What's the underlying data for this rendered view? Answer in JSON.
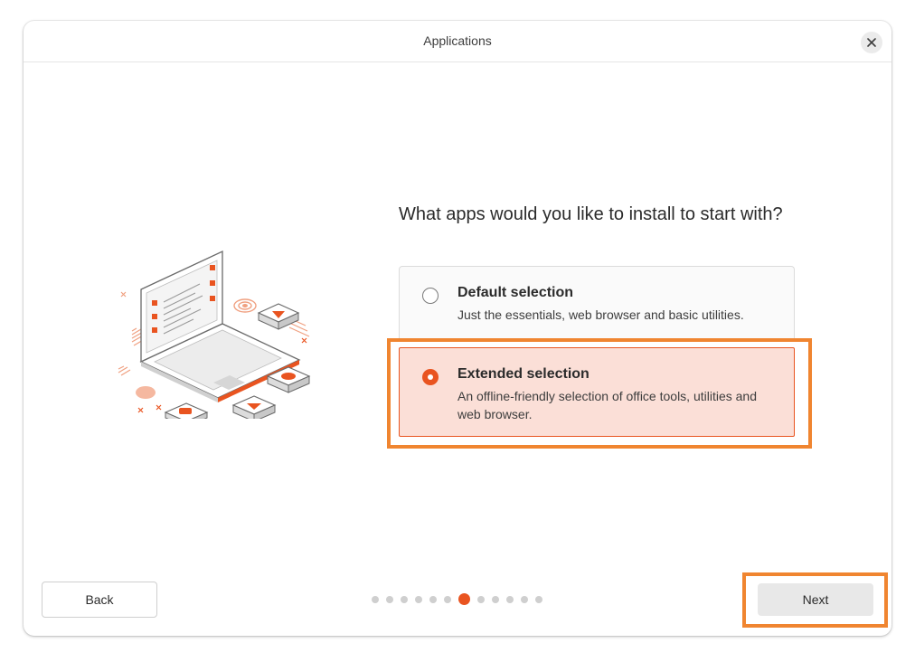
{
  "window": {
    "title": "Applications"
  },
  "page": {
    "question": "What apps would you like to install to start with?"
  },
  "options": [
    {
      "title": "Default selection",
      "description": "Just the essentials, web browser and basic utilities.",
      "selected": false
    },
    {
      "title": "Extended selection",
      "description": "An offline-friendly selection of office tools, utilities and web browser.",
      "selected": true
    }
  ],
  "footer": {
    "back_label": "Back",
    "next_label": "Next",
    "steps_total": 12,
    "current_step": 7
  },
  "colors": {
    "accent": "#e95420",
    "selected_bg": "#fbdfd7",
    "highlight": "#f08530"
  },
  "icons": {
    "close": "close-icon",
    "illustration": "laptop-apps-illustration"
  }
}
